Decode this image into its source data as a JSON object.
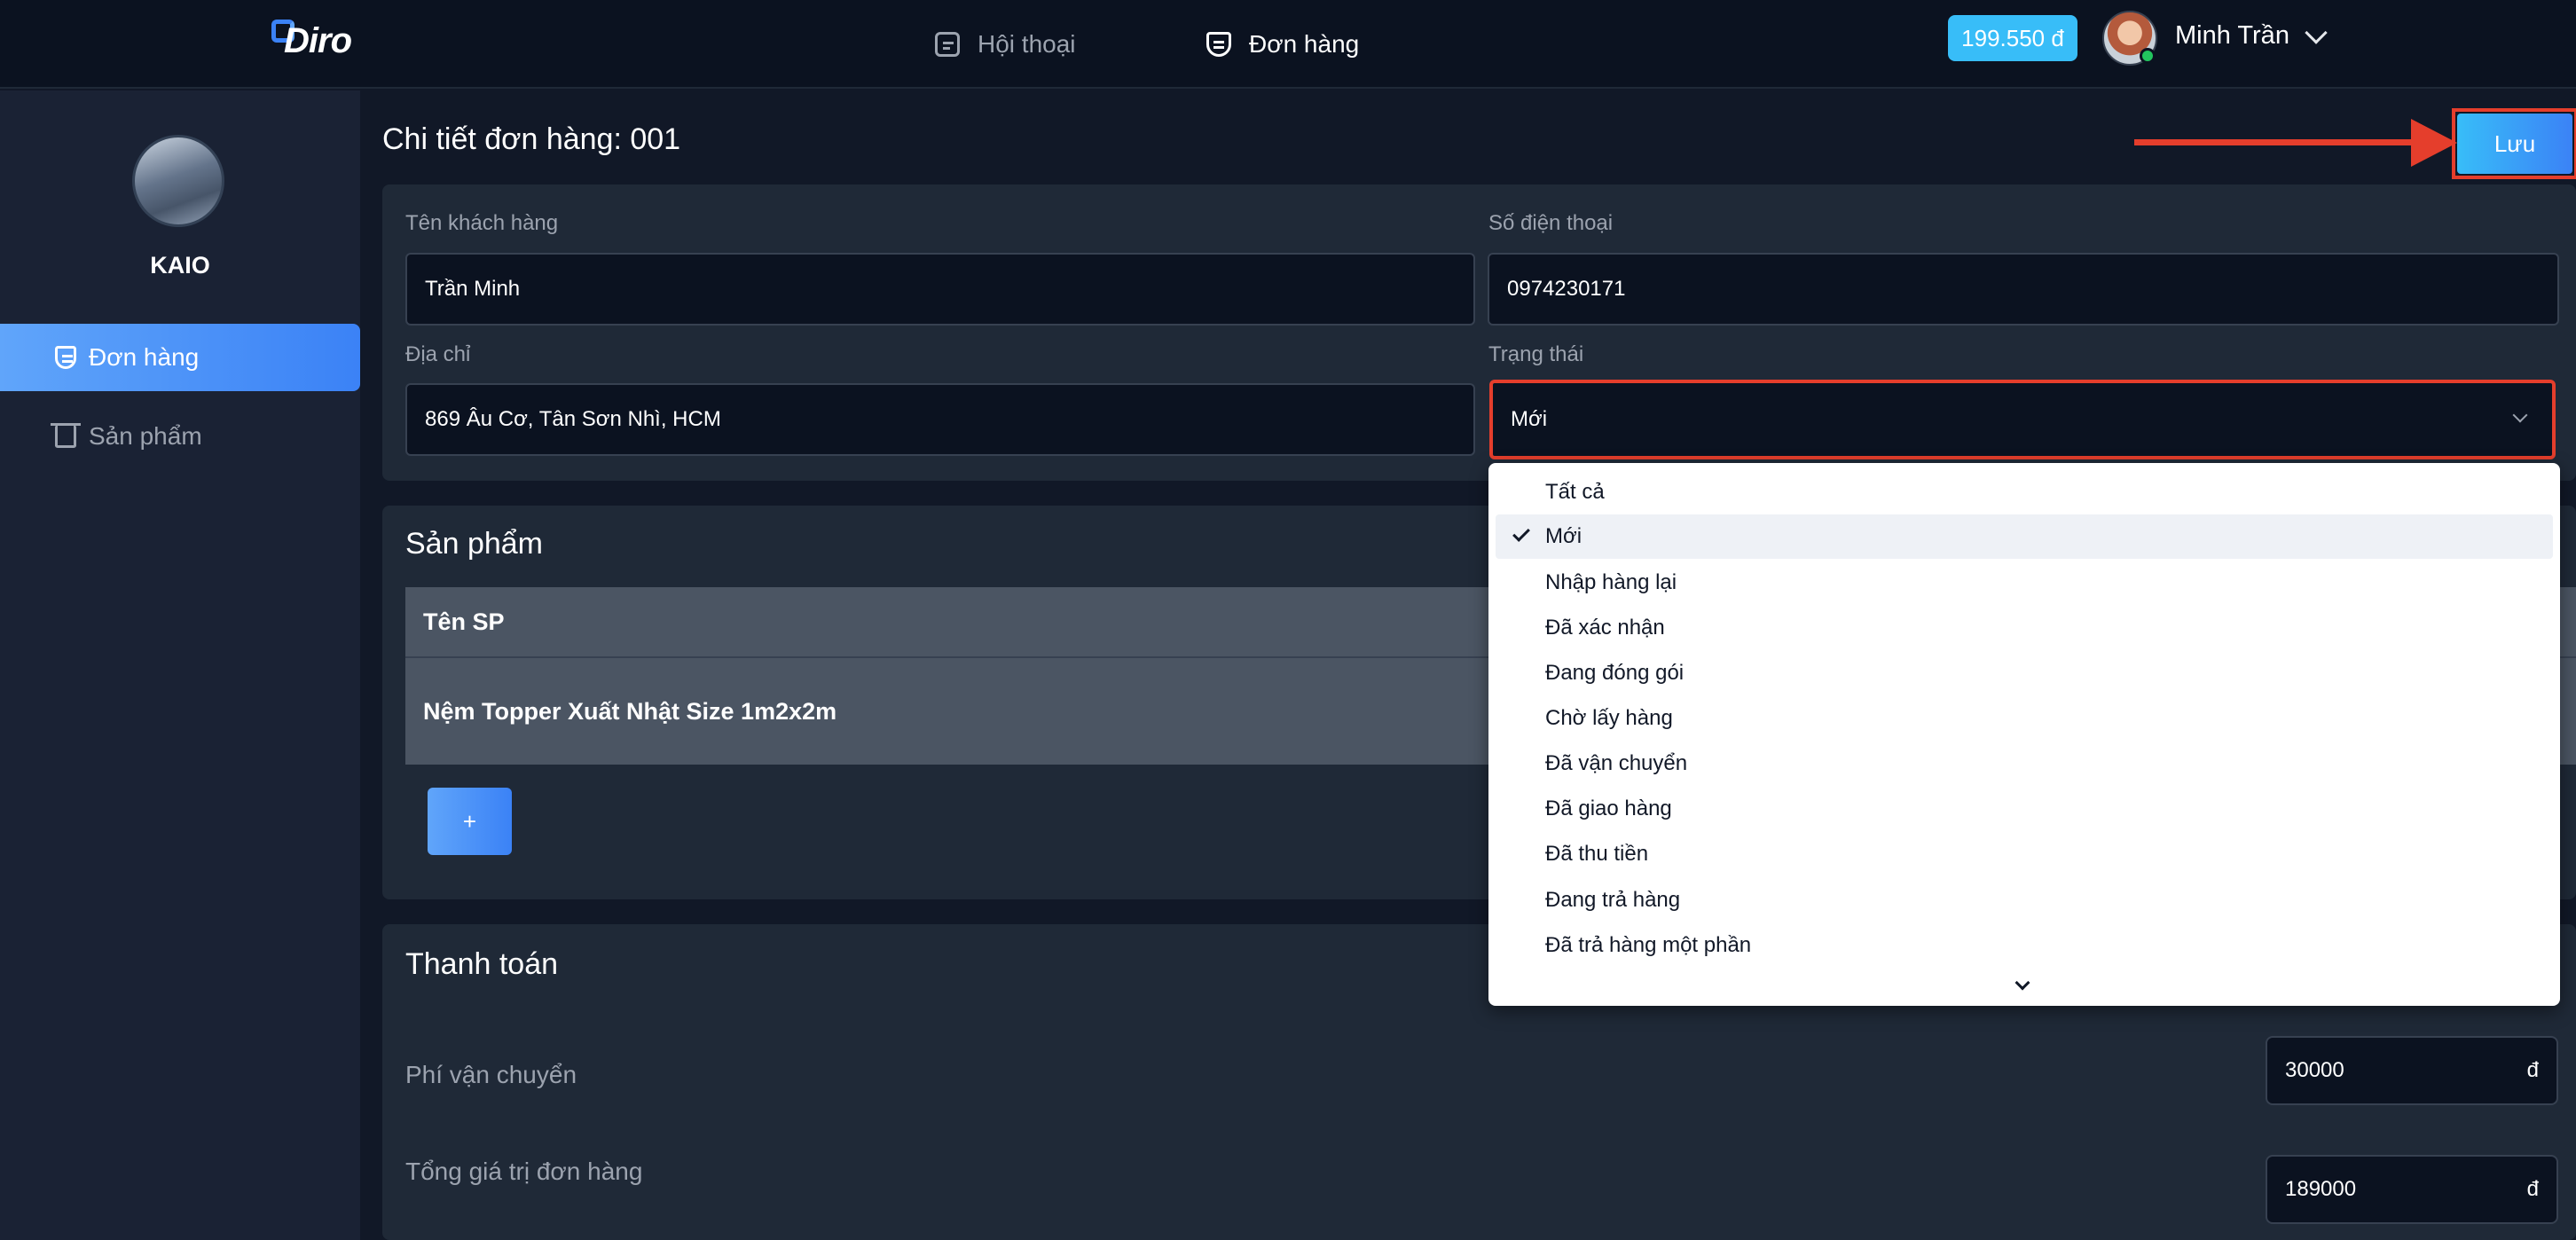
{
  "header": {
    "logo_text": "Diro",
    "nav": [
      {
        "label": "Hội thoại",
        "icon": "chat-icon"
      },
      {
        "label": "Đơn hàng",
        "icon": "shield-list-icon"
      }
    ],
    "balance": "199.550 đ",
    "user_name": "Minh Trần"
  },
  "sidebar": {
    "shop_name": "KAIO",
    "items": [
      {
        "label": "Đơn hàng",
        "icon": "shield-list-icon",
        "active": true
      },
      {
        "label": "Sản phẩm",
        "icon": "shirt-icon",
        "active": false
      }
    ]
  },
  "page": {
    "title": "Chi tiết đơn hàng: 001",
    "save_label": "Lưu"
  },
  "customer": {
    "name_label": "Tên khách hàng",
    "name_value": "Trần Minh",
    "phone_label": "Số điện thoại",
    "phone_value": "0974230171",
    "address_label": "Địa chỉ",
    "address_value": "869 Âu Cơ, Tân Sơn Nhì, HCM",
    "status_label": "Trạng thái",
    "status_value": "Mới"
  },
  "products": {
    "title": "Sản phẩm",
    "column_name": "Tên SP",
    "rows": [
      {
        "name": "Nệm Topper Xuất Nhật Size 1m2x2m"
      }
    ],
    "add_label": "+"
  },
  "payment": {
    "title": "Thanh toán",
    "shipping_label": "Phí vận chuyển",
    "shipping_value": "30000",
    "total_label": "Tổng giá trị đơn hàng",
    "total_value": "189000",
    "currency": "đ"
  },
  "status_dropdown": {
    "options": [
      "Tất cả",
      "Mới",
      "Nhập hàng lại",
      "Đã xác nhận",
      "Đang đóng gói",
      "Chờ lấy hàng",
      "Đã vận chuyển",
      "Đã giao hàng",
      "Đã thu tiền",
      "Đang trả hàng",
      "Đã trả hàng một phần"
    ],
    "selected": "Mới"
  },
  "colors": {
    "accent": "#3b82f6",
    "balance_badge": "#38bdf8",
    "highlight": "#e53e2c"
  }
}
